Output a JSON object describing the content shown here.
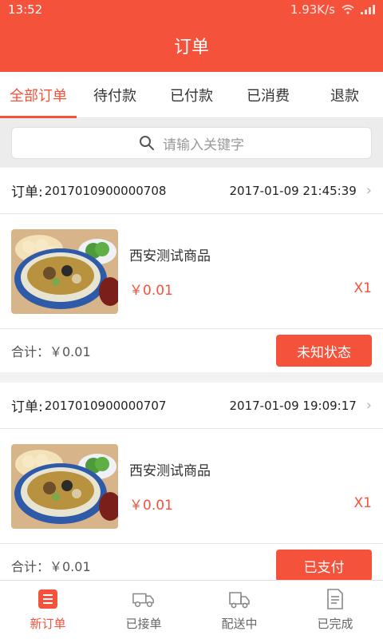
{
  "status_bar": {
    "time": "13:52",
    "speed": "1.93K/s"
  },
  "header": {
    "title": "订单"
  },
  "tabs": [
    {
      "label": "全部订单",
      "active": true
    },
    {
      "label": "待付款",
      "active": false
    },
    {
      "label": "已付款",
      "active": false
    },
    {
      "label": "已消费",
      "active": false
    },
    {
      "label": "退款",
      "active": false
    }
  ],
  "search": {
    "placeholder": "请输入关键字"
  },
  "orders": [
    {
      "label": "订单:",
      "number": "2017010900000708",
      "time": "2017-01-09 21:45:39",
      "product_name": "西安测试商品",
      "price": "￥0.01",
      "quantity": "X1",
      "total": "合计：￥0.01",
      "action": "未知状态"
    },
    {
      "label": "订单:",
      "number": "2017010900000707",
      "time": "2017-01-09 19:09:17",
      "product_name": "西安测试商品",
      "price": "￥0.01",
      "quantity": "X1",
      "total": "合计：￥0.01",
      "action": "已支付"
    }
  ],
  "bottom_nav": [
    {
      "label": "新订单",
      "icon": "list-icon",
      "active": true
    },
    {
      "label": "已接单",
      "icon": "truck-icon",
      "active": false
    },
    {
      "label": "配送中",
      "icon": "delivery-van-icon",
      "active": false
    },
    {
      "label": "已完成",
      "icon": "document-icon",
      "active": false
    }
  ],
  "colors": {
    "accent": "#f5523c",
    "background": "#f2f2f2"
  }
}
